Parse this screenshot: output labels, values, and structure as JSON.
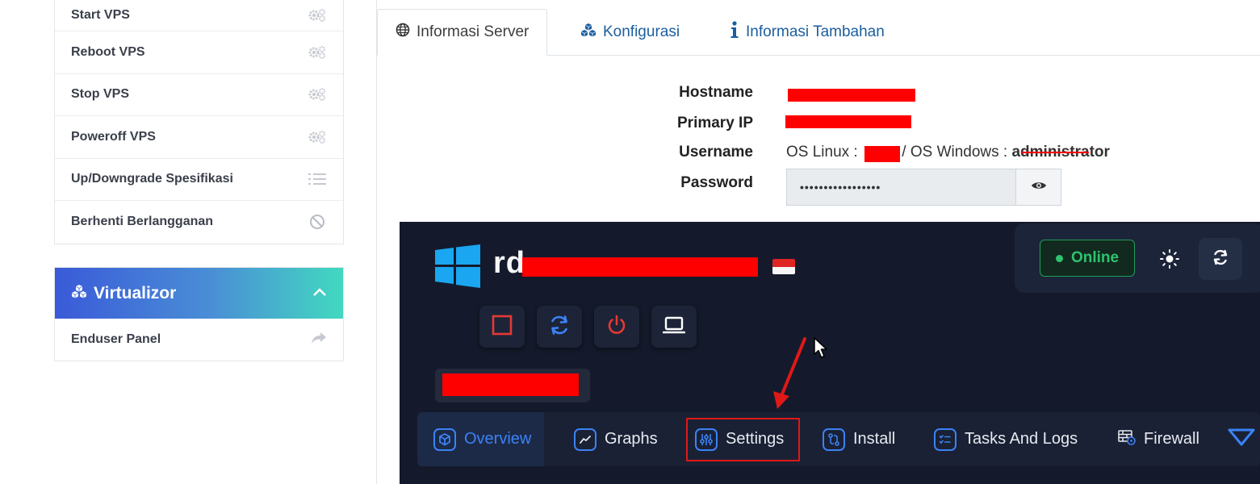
{
  "sidebar": {
    "items": [
      {
        "label": "Start VPS",
        "icon": "gears-icon"
      },
      {
        "label": "Reboot VPS",
        "icon": "gears-icon"
      },
      {
        "label": "Stop VPS",
        "icon": "gears-icon"
      },
      {
        "label": "Poweroff VPS",
        "icon": "gears-icon"
      },
      {
        "label": "Up/Downgrade Spesifikasi",
        "icon": "list-icon"
      },
      {
        "label": "Berhenti Berlangganan",
        "icon": "ban-icon"
      }
    ]
  },
  "virtualizor": {
    "title": "Virtualizor",
    "items": [
      {
        "label": "Enduser Panel",
        "icon": "share-arrow-icon"
      }
    ]
  },
  "tabs": [
    {
      "label": "Informasi Server",
      "icon": "globe-icon",
      "active": true
    },
    {
      "label": "Konfigurasi",
      "icon": "cubes-icon",
      "active": false
    },
    {
      "label": "Informasi Tambahan",
      "icon": "info-icon",
      "active": false
    }
  ],
  "server_info": {
    "hostname_label": "Hostname",
    "primary_ip_label": "Primary IP",
    "username_label": "Username",
    "username_linux_prefix": "OS Linux :",
    "username_windows_prefix": "/ OS Windows :",
    "username_windows_value": "administrator",
    "password_label": "Password",
    "password_masked": "•••••••••••••••••"
  },
  "panel": {
    "server_name_prefix": "rd",
    "status": "Online",
    "nav": [
      {
        "label": "Overview",
        "icon": "cube-icon",
        "active": true
      },
      {
        "label": "Graphs",
        "icon": "chart-line-icon",
        "active": false
      },
      {
        "label": "Settings",
        "icon": "sliders-icon",
        "active": false
      },
      {
        "label": "Install",
        "icon": "git-compare-icon",
        "active": false
      },
      {
        "label": "Tasks And Logs",
        "icon": "checklist-icon",
        "active": false
      },
      {
        "label": "Firewall",
        "icon": "firewall-icon",
        "active": false
      }
    ]
  },
  "colors": {
    "accent_blue": "#3b82f6",
    "online_green": "#2ec36f",
    "redaction": "#ff0000",
    "annotation_red": "#e01818"
  }
}
